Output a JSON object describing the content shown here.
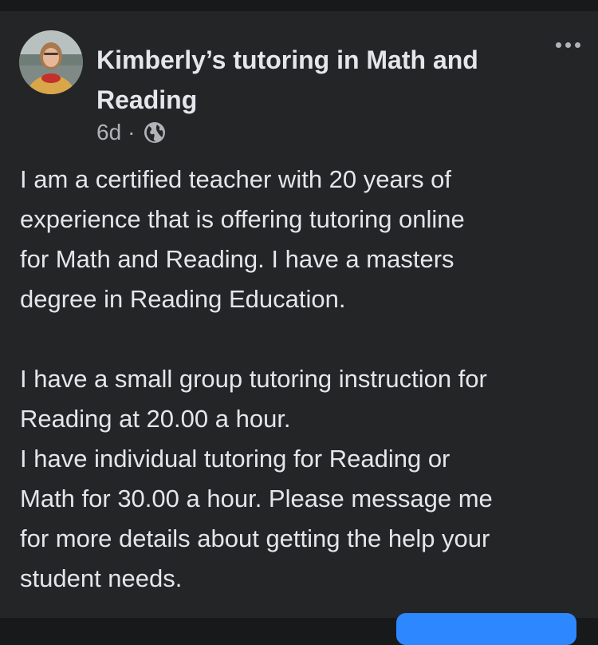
{
  "post": {
    "author": "Kimberly’s tutoring in Math and Reading",
    "timestamp": "6d",
    "separator": "·",
    "audience_icon": "globe-icon",
    "more_icon": "more-horizontal-icon",
    "paragraphs": [
      [
        "I am a certified teacher with 20 years of",
        "experience that is offering tutoring online",
        "for Math and Reading. I have a masters",
        "degree in Reading Education."
      ],
      [
        "I have a small group tutoring instruction for",
        "Reading at 20.00 a hour.",
        "I have individual tutoring for Reading or",
        "Math for 30.00 a hour. Please message me",
        "for more details about getting the help your",
        "student needs."
      ]
    ]
  },
  "colors": {
    "background": "#18191a",
    "card": "#242526",
    "primary_text": "#e4e6eb",
    "secondary_text": "#b0b3b8",
    "accent": "#2d88ff"
  }
}
